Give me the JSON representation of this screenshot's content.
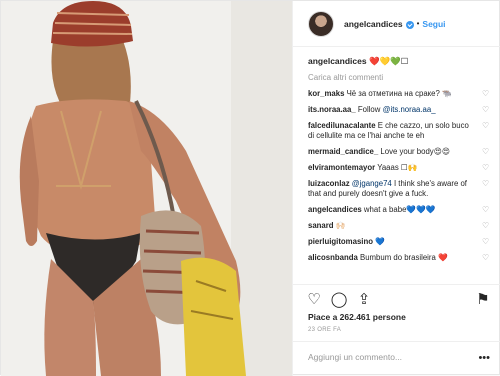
{
  "post": {
    "author": "angelcandices",
    "follow_label": "Segui",
    "caption_text": "❤️💛💚☐",
    "load_more": "Carica altri commenti",
    "likes": "Piace a 262.461 persone",
    "time": "23 ORE FA",
    "add_comment_placeholder": "Aggiungi un commento..."
  },
  "comments": [
    {
      "user": "kor_maks",
      "text": "Чё за отметина на сраке? 🐃"
    },
    {
      "user": "its.noraa.aa_",
      "text": "Follow ",
      "mention": "@its.noraa.aa_"
    },
    {
      "user": "falcedilunacalante",
      "text": "E che cazzo, un solo buco di cellulite ma ce l'hai anche te eh"
    },
    {
      "user": "mermaid_candice_",
      "text": "Love your body😍😍"
    },
    {
      "user": "elviramontemayor",
      "text": "Yaaas ☐🙌"
    },
    {
      "user": "luizaconlaz",
      "mention": "@jgange74",
      "text": " I think she's aware of that and purely doesn't give a fuck."
    },
    {
      "user": "angelcandices",
      "text": "what a babe💙💙💙"
    },
    {
      "user": "sanard",
      "text": "🙌🏻"
    },
    {
      "user": "pierluigitomasino",
      "text": "💙"
    },
    {
      "user": "alicosnbanda",
      "text": "Bumbum do brasileira ❤️"
    }
  ],
  "icons": {
    "heart": "heart-icon",
    "comment": "comment-icon",
    "share": "share-icon",
    "save": "bookmark-icon"
  }
}
